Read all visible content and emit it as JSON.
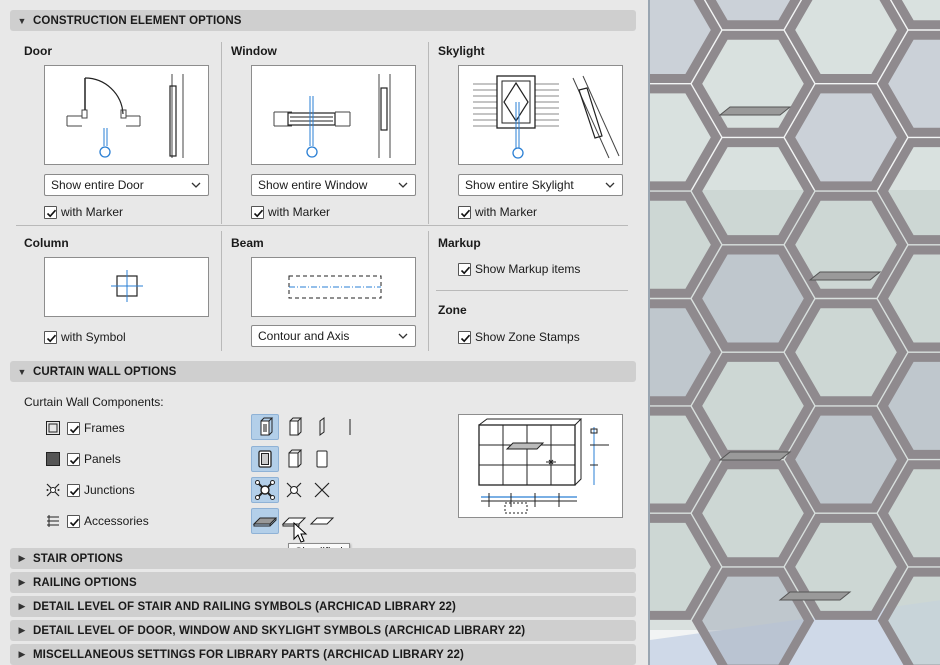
{
  "sections": {
    "construction": "CONSTRUCTION ELEMENT OPTIONS",
    "curtain_wall": "CURTAIN WALL OPTIONS",
    "stair": "STAIR OPTIONS",
    "railing": "RAILING OPTIONS",
    "detail_stair_railing": "DETAIL LEVEL OF STAIR AND RAILING SYMBOLS (ARCHICAD LIBRARY 22)",
    "detail_door_window": "DETAIL LEVEL OF DOOR, WINDOW AND SKYLIGHT SYMBOLS (ARCHICAD LIBRARY 22)",
    "misc": "MISCELLANEOUS SETTINGS FOR LIBRARY PARTS (ARCHICAD LIBRARY 22)"
  },
  "door": {
    "title": "Door",
    "select_value": "Show entire Door",
    "marker_label": "with Marker"
  },
  "window": {
    "title": "Window",
    "select_value": "Show entire Window",
    "marker_label": "with Marker"
  },
  "skylight": {
    "title": "Skylight",
    "select_value": "Show entire Skylight",
    "marker_label": "with Marker"
  },
  "column": {
    "title": "Column",
    "symbol_label": "with Symbol"
  },
  "beam": {
    "title": "Beam",
    "select_value": "Contour and Axis"
  },
  "markup": {
    "title": "Markup",
    "checkbox_label": "Show Markup items"
  },
  "zone": {
    "title": "Zone",
    "checkbox_label": "Show Zone Stamps"
  },
  "curtain_wall": {
    "components_label": "Curtain Wall Components:",
    "rows": [
      {
        "label": "Frames",
        "icon": "frame-icon"
      },
      {
        "label": "Panels",
        "icon": "panel-icon"
      },
      {
        "label": "Junctions",
        "icon": "junction-icon"
      },
      {
        "label": "Accessories",
        "icon": "accessory-icon"
      }
    ]
  },
  "tooltip": "Simplified",
  "colors": {
    "selected": "#b3cfe9",
    "accent_blue": "#2a7fd4",
    "header": "#cfcfcf"
  }
}
